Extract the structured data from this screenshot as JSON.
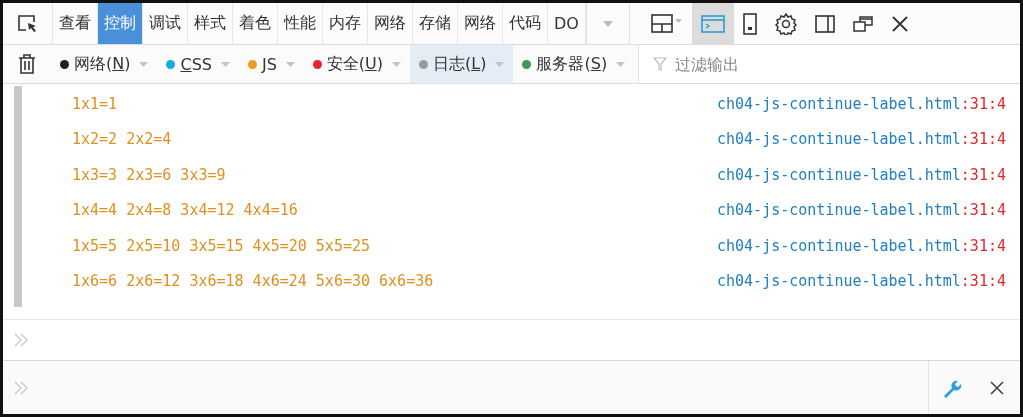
{
  "tabs": [
    {
      "label": "查看",
      "selected": false
    },
    {
      "label": "控制",
      "selected": true
    },
    {
      "label": "调试",
      "selected": false
    },
    {
      "label": "样式",
      "selected": false
    },
    {
      "label": "着色",
      "selected": false
    },
    {
      "label": "性能",
      "selected": false
    },
    {
      "label": "内存",
      "selected": false
    },
    {
      "label": "网络",
      "selected": false
    },
    {
      "label": "存储",
      "selected": false
    },
    {
      "label": "网络",
      "selected": false
    },
    {
      "label": "代码",
      "selected": false
    },
    {
      "label": "DO",
      "selected": false
    }
  ],
  "toolbar_icons": [
    {
      "kind": "layout",
      "selected": false
    },
    {
      "kind": "console",
      "selected": true
    },
    {
      "kind": "phone",
      "selected": false
    },
    {
      "kind": "gear",
      "selected": false
    },
    {
      "kind": "sidebar",
      "selected": false
    },
    {
      "kind": "windows",
      "selected": false
    },
    {
      "kind": "close",
      "selected": false
    }
  ],
  "filters": [
    {
      "before": "网络(",
      "key": "N",
      "after": ")",
      "color": "#222222",
      "selected": false
    },
    {
      "key": "C",
      "after": "SS",
      "color": "#1ba9e0",
      "selected": false
    },
    {
      "key": "J",
      "after": "S",
      "color": "#f39a1c",
      "selected": false
    },
    {
      "before": "安全(",
      "key": "U",
      "after": ")",
      "color": "#e5262b",
      "selected": false
    },
    {
      "before": "日志(",
      "key": "L",
      "after": ")",
      "color": "#9a9a9a",
      "selected": true
    },
    {
      "before": "服务器(",
      "key": "S",
      "after": ")",
      "color": "#3f9a4f",
      "selected": false
    }
  ],
  "filter_field": {
    "placeholder": "过滤输出"
  },
  "log": [
    {
      "message": "1x1=1",
      "source": "ch04-js-continue-label.html",
      "location": ":31:4"
    },
    {
      "message": "1x2=2 2x2=4",
      "source": "ch04-js-continue-label.html",
      "location": ":31:4"
    },
    {
      "message": "1x3=3 2x3=6 3x3=9",
      "source": "ch04-js-continue-label.html",
      "location": ":31:4"
    },
    {
      "message": "1x4=4 2x4=8 3x4=12 4x4=16",
      "source": "ch04-js-continue-label.html",
      "location": ":31:4"
    },
    {
      "message": "1x5=5 2x5=10 3x5=15 4x5=20 5x5=25",
      "source": "ch04-js-continue-label.html",
      "location": ":31:4"
    },
    {
      "message": "1x6=6 2x6=12 3x6=18 4x6=24 5x6=30 6x6=36",
      "source": "ch04-js-continue-label.html",
      "location": ":31:4"
    }
  ]
}
